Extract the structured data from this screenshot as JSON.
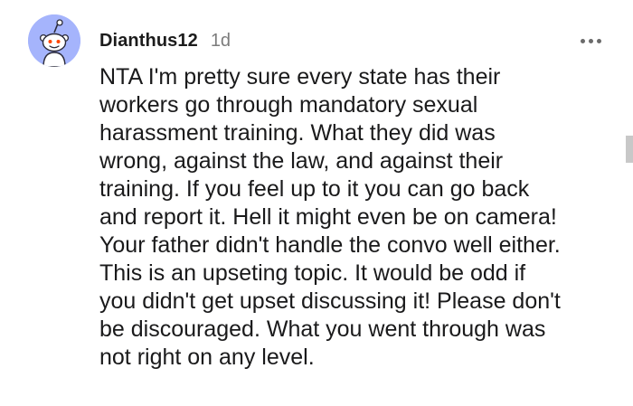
{
  "comment": {
    "author": "Dianthus12",
    "timestamp": "1d",
    "body": "NTA I'm pretty sure every state has their\nworkers go through mandatory sexual\nharassment training. What they did was\nwrong, against the law, and against their\ntraining. If you feel up to it you can go back\nand report it. Hell it might even be on camera!\nYour father didn't handle the convo well either.\nThis is an upseting topic. It would be odd if\nyou didn't get upset discussing it! Please don't\nbe discouraged. What you went through was\nnot right on any level.",
    "avatar_icon": "snoo-avatar-icon",
    "avatar_color": "#a5b4fc",
    "more_icon": "more-options-icon"
  },
  "colors": {
    "author": "#1c1c1c",
    "timestamp": "#7c7c7c",
    "text": "#1a1a1b"
  }
}
